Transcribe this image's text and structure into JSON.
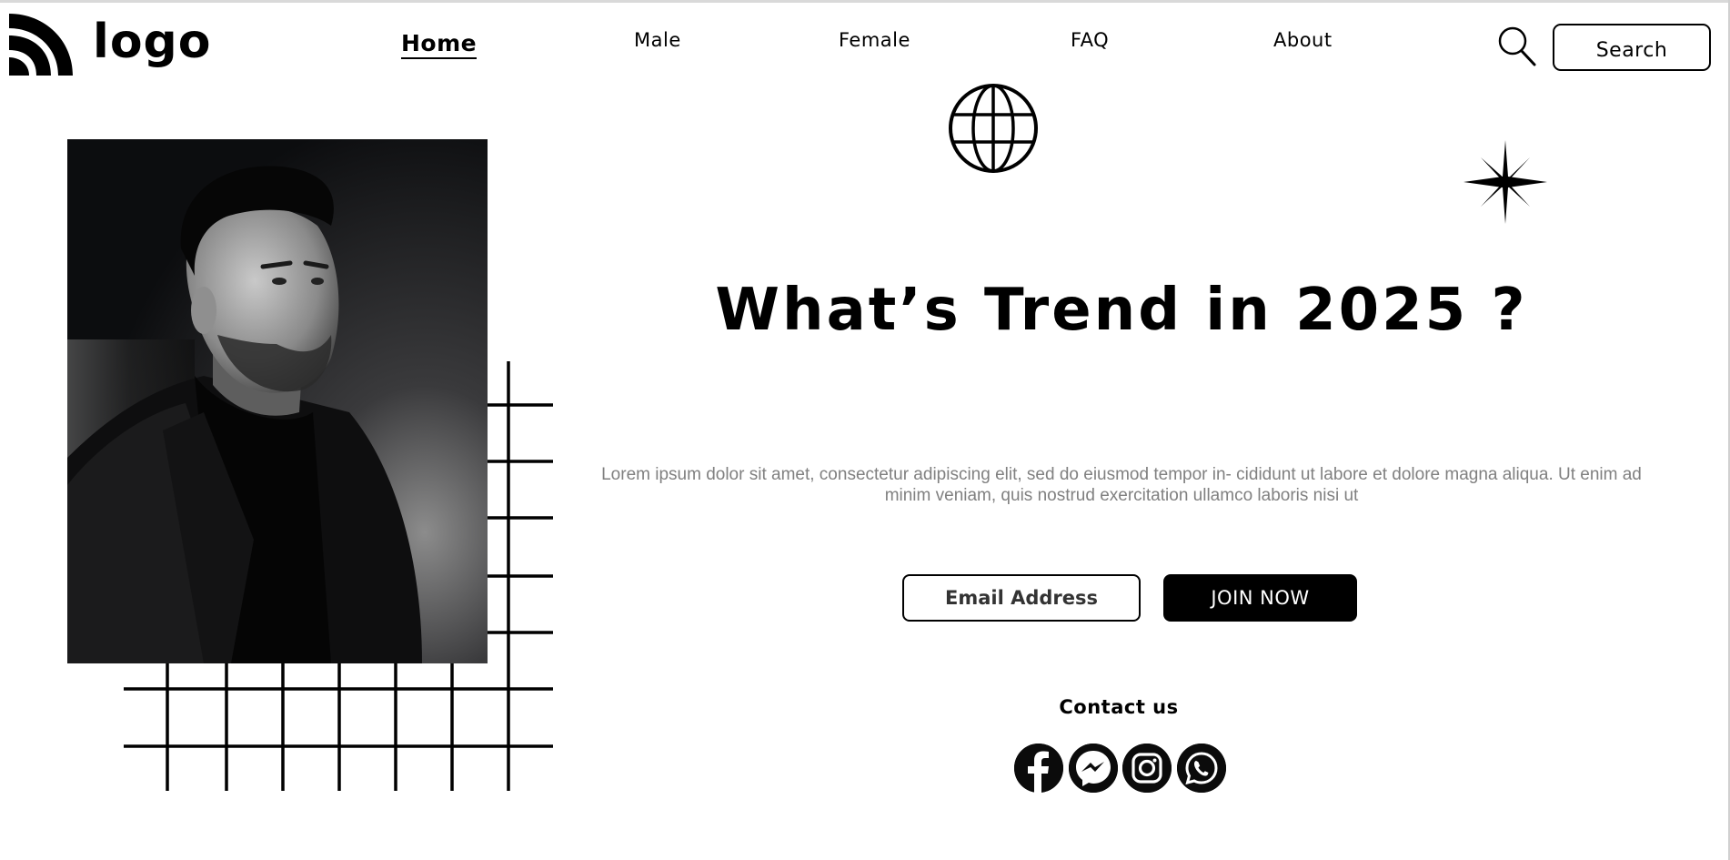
{
  "header": {
    "logo_text": "logo",
    "nav": [
      {
        "label": "Home"
      },
      {
        "label": "Male"
      },
      {
        "label": "Female"
      },
      {
        "label": "FAQ"
      },
      {
        "label": "About"
      }
    ],
    "search_label": "Search"
  },
  "hero": {
    "headline": "What’s Trend in 2025 ?",
    "description": "Lorem ipsum dolor sit amet, consectetur adipiscing elit, sed do eiusmod tempor in- cididunt ut labore et dolore magna aliqua. Ut enim ad minim veniam, quis nostrud exercitation ullamco laboris nisi ut",
    "email_placeholder": "Email Address",
    "join_label": "JOIN NOW"
  },
  "contact": {
    "title": "Contact us",
    "icons": [
      "facebook-icon",
      "messenger-icon",
      "instagram-icon",
      "whatsapp-icon"
    ]
  },
  "colors": {
    "background": "#ffffff",
    "text": "#000000",
    "muted_text": "#808080",
    "button_bg": "#000000",
    "button_text": "#ffffff"
  }
}
